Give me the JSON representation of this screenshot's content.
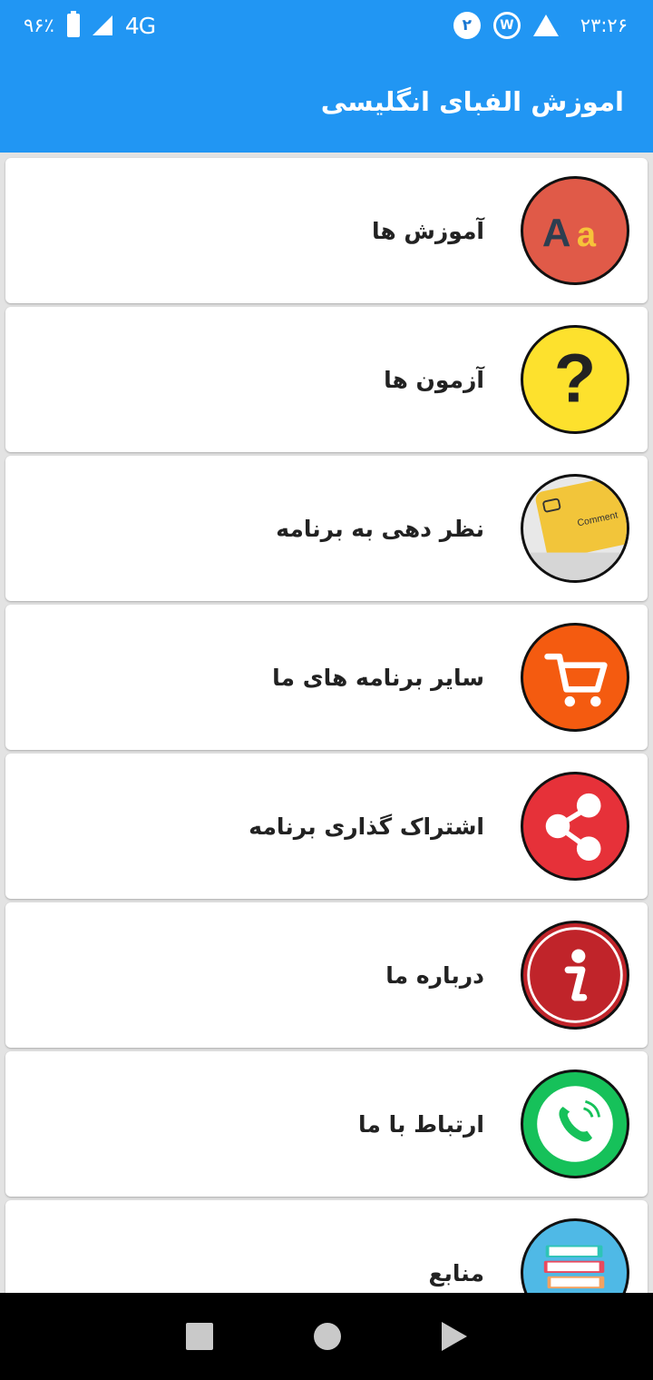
{
  "status_bar": {
    "time": "۲۳:۲۶",
    "battery": "۹۶٪",
    "network": "4G",
    "notification_count": "۲"
  },
  "app_bar": {
    "title": "اموزش الفبای انگلیسی"
  },
  "menu": [
    {
      "label": "آموزش ها",
      "icon": "alphabet-icon",
      "color": "#e05a48"
    },
    {
      "label": "آزمون ها",
      "icon": "question-icon",
      "color": "#fde12d"
    },
    {
      "label": "نظر دهی به برنامه",
      "icon": "comment-key-icon",
      "color": "#f2c53a",
      "icon_text": "Comment"
    },
    {
      "label": "سایر برنامه های ما",
      "icon": "cart-icon",
      "color": "#f45b10"
    },
    {
      "label": "اشتراک گذاری برنامه",
      "icon": "share-icon",
      "color": "#e63139"
    },
    {
      "label": "درباره ما",
      "icon": "info-icon",
      "color": "#c0242a"
    },
    {
      "label": "ارتباط با ما",
      "icon": "phone-icon",
      "color": "#16c15a"
    },
    {
      "label": "منابع",
      "icon": "books-icon",
      "color": "#4fb9e6"
    }
  ]
}
